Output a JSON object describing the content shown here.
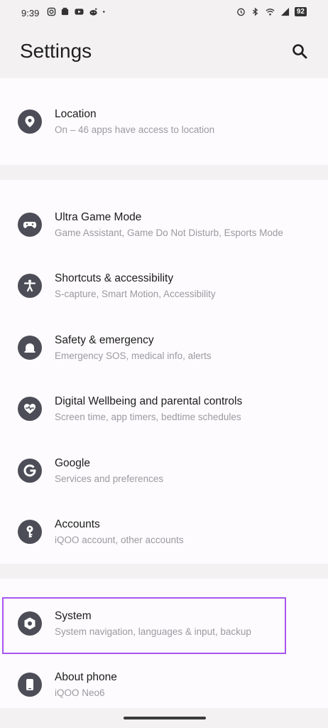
{
  "status_bar": {
    "time": "9:39",
    "battery": "92",
    "left_icons": [
      "instagram-icon",
      "notification-icon",
      "youtube-icon",
      "reddit-icon",
      "dot-icon"
    ],
    "right_icons": [
      "alarm-icon",
      "bluetooth-icon",
      "wifi-icon",
      "signal-icon"
    ]
  },
  "header": {
    "title": "Settings",
    "search_icon": "search-icon"
  },
  "sections": [
    {
      "items": [
        {
          "title": "Location",
          "subtitle": "On – 46 apps have access to location",
          "icon": "location-icon"
        }
      ]
    },
    {
      "items": [
        {
          "title": "Ultra Game Mode",
          "subtitle": "Game Assistant, Game Do Not Disturb, Esports Mode",
          "icon": "gamepad-icon"
        },
        {
          "title": "Shortcuts & accessibility",
          "subtitle": "S-capture, Smart Motion, Accessibility",
          "icon": "accessibility-icon"
        },
        {
          "title": "Safety & emergency",
          "subtitle": "Emergency SOS, medical info, alerts",
          "icon": "emergency-icon"
        },
        {
          "title": "Digital Wellbeing and parental controls",
          "subtitle": "Screen time, app timers, bedtime schedules",
          "icon": "heart-icon"
        },
        {
          "title": "Google",
          "subtitle": "Services and preferences",
          "icon": "google-icon"
        },
        {
          "title": "Accounts",
          "subtitle": "iQOO account, other accounts",
          "icon": "key-icon"
        }
      ]
    },
    {
      "items": [
        {
          "title": "System",
          "subtitle": "System navigation, languages & input, backup",
          "icon": "gear-icon"
        },
        {
          "title": "About phone",
          "subtitle": "iQOO Neo6",
          "icon": "phone-icon"
        }
      ]
    }
  ],
  "colors": {
    "background": "#f3f1f2",
    "card": "#fdfbfd",
    "icon_bg": "#4d4d58",
    "highlight": "#a757f0"
  }
}
